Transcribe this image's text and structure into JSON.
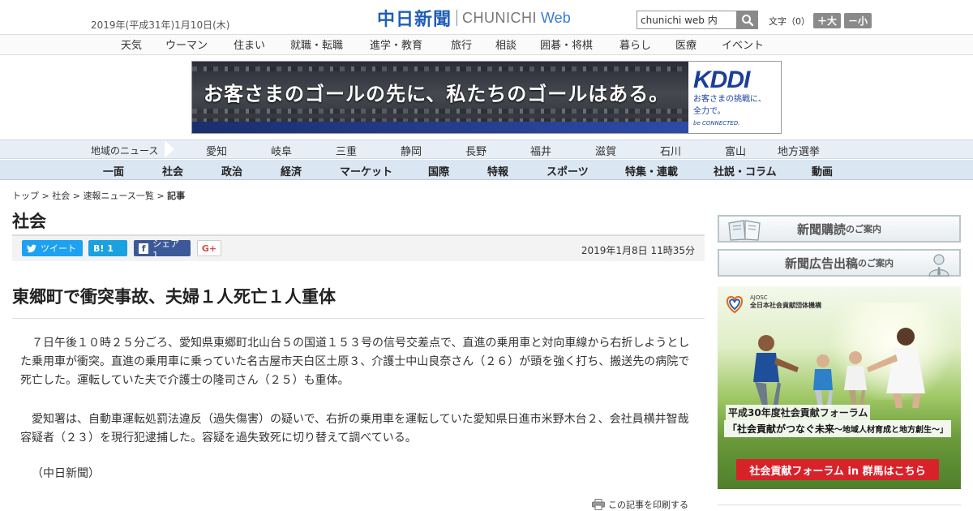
{
  "header": {
    "date": "2019年(平成31年)1月10日(木)",
    "logo_jp": "中日新聞",
    "logo_en": "CHUNICHI",
    "logo_web": "Web",
    "search_placeholder": "chunichi web 内",
    "font_size_label": "文字（0）",
    "font_larger": "＋大",
    "font_smaller": "－小"
  },
  "top_nav": [
    "天気",
    "ウーマン",
    "住まい",
    "就職・転職",
    "進学・教育",
    "旅行",
    "相談",
    "囲碁・将棋",
    "暮らし",
    "医療",
    "イベント"
  ],
  "banner": {
    "copy": "お客さまのゴールの先に、私たちのゴールはある。",
    "brand": "KDDI",
    "sub1": "お客さまの挑戦に、",
    "sub2": "全力で。",
    "tagline": "be CONNECTED."
  },
  "region_nav": {
    "label": "地域のニュース",
    "items": [
      "愛知",
      "岐阜",
      "三重",
      "静岡",
      "長野",
      "福井",
      "滋賀",
      "石川",
      "富山",
      "地方選挙"
    ]
  },
  "category_nav": [
    "一面",
    "社会",
    "政治",
    "経済",
    "マーケット",
    "国際",
    "特報",
    "スポーツ",
    "特集・連載",
    "社説・コラム",
    "動画"
  ],
  "breadcrumb": {
    "items": [
      "トップ",
      "社会",
      "速報ニュース一覧"
    ],
    "current": "記事",
    "separator": " > "
  },
  "section_title": "社会",
  "share": {
    "tweet": "ツイート",
    "hatena": "B! 1",
    "facebook": "シェア 1",
    "gplus": "G+"
  },
  "timestamp": "2019年1月8日 11時35分",
  "article": {
    "headline": "東郷町で衝突事故、夫婦１人死亡１人重体",
    "paragraphs": [
      "７日午後１０時２５分ごろ、愛知県東郷町北山台５の国道１５３号の信号交差点で、直進の乗用車と対向車線から右折しようとした乗用車が衝突。直進の乗用車に乗っていた名古屋市天白区土原３、介護士中山良奈さん（２６）が頭を強く打ち、搬送先の病院で死亡した。運転していた夫で介護士の隆司さん（２５）も重体。",
      "愛知署は、自動車運転処罰法違反（過失傷害）の疑いで、右折の乗用車を運転していた愛知県日進市米野木台２、会社員横井智哉容疑者（２３）を現行犯逮捕した。容疑を過失致死に切り替えて調べている。",
      "（中日新聞）"
    ],
    "print": "この記事を印刷する"
  },
  "sidebar": {
    "subscribe_main": "新聞購読",
    "subscribe_sub": "のご案内",
    "ad_main": "新聞広告出稿",
    "ad_sub": "のご案内",
    "ad_banner": {
      "org_en": "AJOSC",
      "org_jp": "全日本社会貢献団体機構",
      "title1": "平成30年度社会貢献フォーラム",
      "title2": "「社会貢献がつなぐ未来",
      "title2_sub": "～地域人材育成と地方創生～」",
      "button": "社会貢献フォーラム in 群馬はこちら"
    }
  },
  "colors": {
    "brand_blue": "#1f5fb5",
    "twitter": "#1da1f2",
    "hatena": "#1aa1e0",
    "facebook": "#3b5998",
    "ad_red": "#d8222a"
  }
}
